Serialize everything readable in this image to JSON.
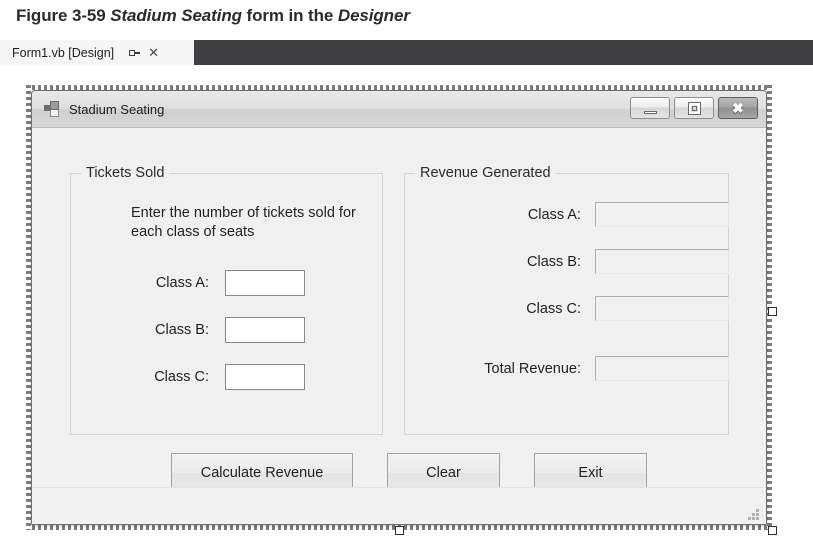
{
  "figure": {
    "prefix": "Figure 3-59 ",
    "emphasis1": "Stadium Seating",
    "middle": " form in the ",
    "emphasis2": "Designer"
  },
  "ide": {
    "tab": {
      "label": "Form1.vb [Design]",
      "pin_icon": "pin-icon",
      "close_icon": "✕"
    }
  },
  "form": {
    "title": "Stadium Seating",
    "icon": "vb-form-icon",
    "window_controls": {
      "minimize": "minimize-icon",
      "maximize": "maximize-icon",
      "close": "✖"
    },
    "groups": {
      "tickets_sold": {
        "label": "Tickets Sold",
        "instruction": "Enter the number of tickets sold for each class of seats",
        "rows": [
          {
            "label": "Class A:",
            "value": ""
          },
          {
            "label": "Class B:",
            "value": ""
          },
          {
            "label": "Class C:",
            "value": ""
          }
        ]
      },
      "revenue_generated": {
        "label": "Revenue Generated",
        "rows": [
          {
            "label": "Class A:",
            "value": ""
          },
          {
            "label": "Class B:",
            "value": ""
          },
          {
            "label": "Class C:",
            "value": ""
          },
          {
            "label": "Total Revenue:",
            "value": ""
          }
        ]
      }
    },
    "buttons": {
      "calculate": "Calculate Revenue",
      "clear": "Clear",
      "exit": "Exit"
    },
    "size_grip": "size-grip-icon"
  },
  "colors": {
    "form_background": "#f0f0f0",
    "tab_dark_bar": "#3f3f41",
    "groupbox_border": "#d2d2d2",
    "input_border": "#888888",
    "output_border": "#b0b0b0",
    "caption_text": "#2b2b2b"
  }
}
